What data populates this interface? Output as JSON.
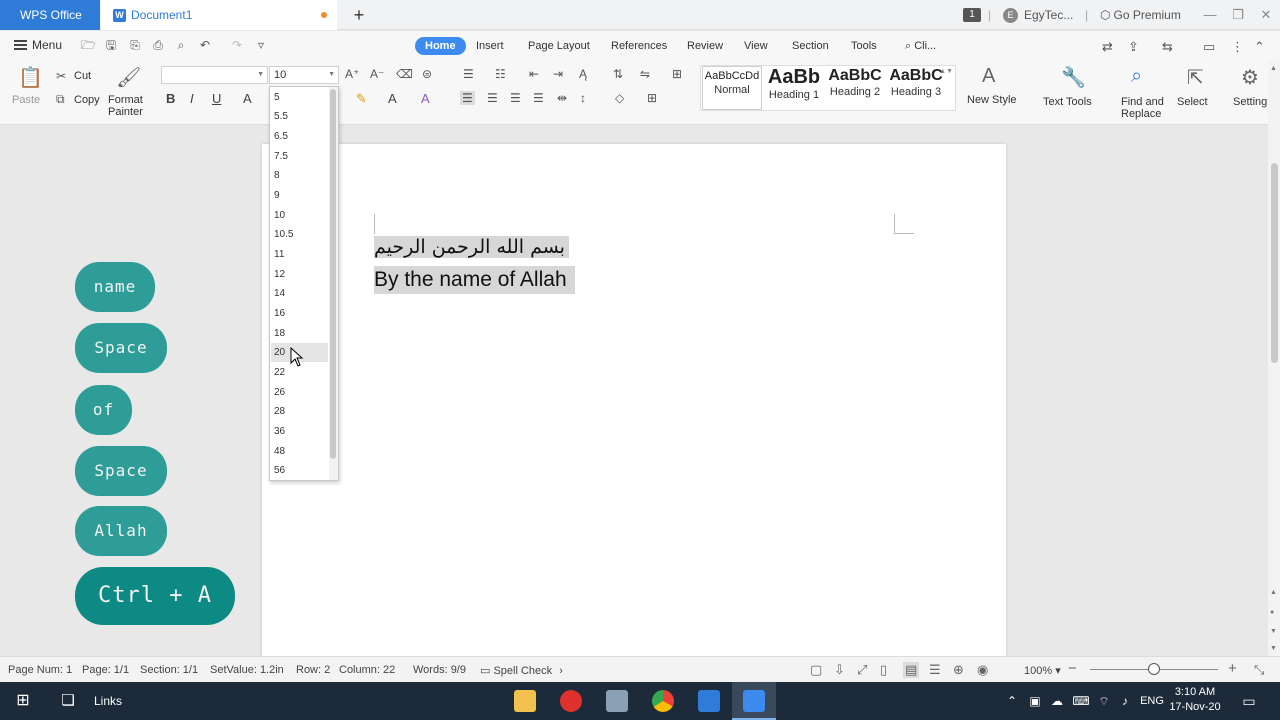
{
  "titlebar": {
    "app_tab": "WPS Office",
    "doc_tab": "Document1",
    "doc_icon": "W",
    "new_tab": "+",
    "page_badge": "1",
    "account_initial": "E",
    "account": "EgyTec...",
    "go_premium": "Go Premium"
  },
  "menurow": {
    "menu": "Menu",
    "tabs": [
      "Home",
      "Insert",
      "Page Layout",
      "References",
      "Review",
      "View",
      "Section",
      "Tools"
    ],
    "search": "Cli..."
  },
  "ribbon": {
    "paste": "Paste",
    "cut": "Cut",
    "copy": "Copy",
    "format_painter_1": "Format",
    "format_painter_2": "Painter",
    "font_name": "",
    "font_size": "10",
    "styles": [
      {
        "sample": "AaBbCcDd",
        "name": "Normal"
      },
      {
        "sample": "AaBb",
        "name": "Heading 1"
      },
      {
        "sample": "AaBbC",
        "name": "Heading 2"
      },
      {
        "sample": "AaBbC",
        "name": "Heading 3"
      }
    ],
    "new_style": "New Style",
    "text_tools": "Text Tools",
    "find_replace_1": "Find and",
    "find_replace_2": "Replace",
    "select": "Select",
    "settings": "Setting"
  },
  "document": {
    "line1": "بسم الله الرحمن الرحيم",
    "line2": "By the name of Allah"
  },
  "font_size_dropdown": {
    "options": [
      "5",
      "5.5",
      "6.5",
      "7.5",
      "8",
      "9",
      "10",
      "10.5",
      "11",
      "12",
      "14",
      "16",
      "18",
      "20",
      "22",
      "26",
      "28",
      "36",
      "48",
      "56"
    ],
    "hovered": "20"
  },
  "overlay_pills": [
    "name",
    "Space",
    "of",
    "Space",
    "Allah",
    "Ctrl + A"
  ],
  "statusbar": {
    "page_num": "Page Num: 1",
    "page": "Page: 1/1",
    "section": "Section: 1/1",
    "setvalue": "SetValue: 1.2in",
    "row": "Row: 2",
    "column": "Column: 22",
    "words": "Words: 9/9",
    "spell_check": "Spell Check",
    "zoom": "100%"
  },
  "taskbar": {
    "links": "Links",
    "lang": "ENG",
    "time": "3:10 AM",
    "date": "17-Nov-20"
  },
  "colors": {
    "accent": "#3d8bef",
    "wps_tab": "#2f7bd8",
    "pill": "#2e9d97",
    "pill_big": "#0e8a84",
    "taskbar": "#1c2a3a"
  }
}
